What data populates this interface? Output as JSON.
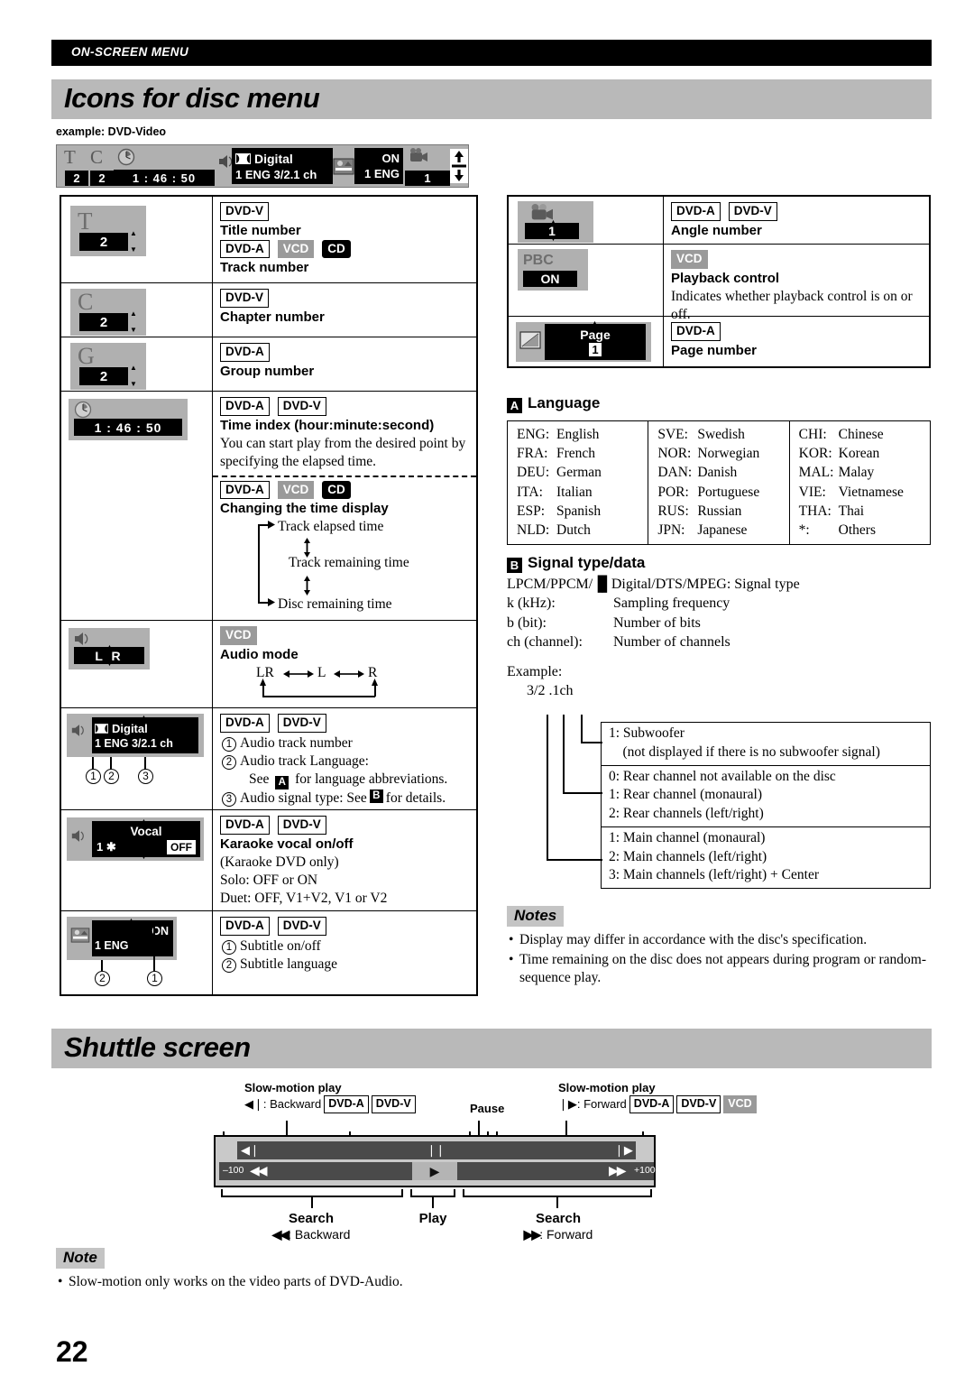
{
  "running_head": "ON-SCREEN MENU",
  "page_number": "22",
  "sections": {
    "icons_for_disc_menu": "Icons for disc menu",
    "shuttle_screen": "Shuttle screen"
  },
  "example_label": "example: DVD-Video",
  "osd_example": {
    "title_icon": "T",
    "title_value": "2",
    "chapter_icon": "C",
    "chapter_value": "2",
    "clock_icon": "clock",
    "time_value": "1 : 46 : 50",
    "speaker_icon": "speaker",
    "audio_format": "Digital",
    "audio_line2": "1 ENG   3/2.1 ch",
    "subtitle_icon": "subtitle",
    "subtitle_on": "ON",
    "subtitle_lang": "1  ENG",
    "angle_icon": "camera",
    "angle_value": "1",
    "updown_icon": "up-down-arrows"
  },
  "badges": {
    "dvd_a": "DVD-A",
    "dvd_v": "DVD-V",
    "vcd": "VCD",
    "cd": "CD"
  },
  "table_left": [
    {
      "id": "title-track-number",
      "thumb": {
        "glyph": "T",
        "value": "2"
      },
      "lines": [
        {
          "type": "badges",
          "items": [
            "DVD-V"
          ]
        },
        {
          "type": "head",
          "text": "Title number"
        },
        {
          "type": "badges",
          "items": [
            "DVD-A",
            "VCD",
            "CD"
          ]
        },
        {
          "type": "head",
          "text": "Track number"
        }
      ]
    },
    {
      "id": "chapter-number",
      "thumb": {
        "glyph": "C",
        "value": "2"
      },
      "lines": [
        {
          "type": "badges",
          "items": [
            "DVD-V"
          ]
        },
        {
          "type": "head",
          "text": "Chapter number"
        }
      ]
    },
    {
      "id": "group-number",
      "thumb": {
        "glyph": "G",
        "value": "2"
      },
      "lines": [
        {
          "type": "badges",
          "items": [
            "DVD-A"
          ]
        },
        {
          "type": "head",
          "text": "Group number"
        }
      ]
    },
    {
      "id": "time-index",
      "thumb": {
        "glyph": "clock",
        "value": "1 : 46 : 50"
      },
      "lines": [
        {
          "type": "badges",
          "items": [
            "DVD-A",
            "DVD-V"
          ]
        },
        {
          "type": "head",
          "text": "Time index (hour:minute:second)"
        },
        {
          "type": "body",
          "text": "You can start play from the desired point by specifying the elapsed time."
        },
        {
          "type": "dashed"
        },
        {
          "type": "badges",
          "items": [
            "DVD-A",
            "VCD",
            "CD"
          ]
        },
        {
          "type": "head",
          "text": "Changing the time display"
        },
        {
          "type": "cycle",
          "items": [
            "Track elapsed time",
            "Track remaining time",
            "Disc remaining time"
          ]
        }
      ]
    },
    {
      "id": "audio-mode",
      "thumb": {
        "glyph": "speaker",
        "value": "L  R"
      },
      "lines": [
        {
          "type": "badges",
          "items": [
            "VCD"
          ]
        },
        {
          "type": "head",
          "text": "Audio mode"
        },
        {
          "type": "lrcycle",
          "items": [
            "LR",
            "L",
            "R"
          ]
        }
      ]
    },
    {
      "id": "audio-track",
      "thumb": {
        "glyph": "speaker-digital",
        "value": "1 ENG  3/2.1 ch",
        "format": "Digital",
        "callouts": [
          "1",
          "2",
          "3"
        ]
      },
      "lines": [
        {
          "type": "badges",
          "items": [
            "DVD-A",
            "DVD-V"
          ]
        },
        {
          "type": "numbered",
          "num": "1",
          "text": "Audio track number"
        },
        {
          "type": "numbered",
          "num": "2",
          "text": "Audio track Language:"
        },
        {
          "type": "indent-ref",
          "pre": "See ",
          "badge": "A",
          "post": " for language abbreviations."
        },
        {
          "type": "numbered-ref",
          "num": "3",
          "pre": "Audio signal type: See ",
          "badge": "B",
          "post": " for details."
        }
      ]
    },
    {
      "id": "karaoke-vocal",
      "thumb": {
        "glyph": "speaker-vocal",
        "label": "Vocal",
        "value": "1  ✱",
        "state": "OFF"
      },
      "lines": [
        {
          "type": "badges",
          "items": [
            "DVD-A",
            "DVD-V"
          ]
        },
        {
          "type": "head",
          "text": "Karaoke vocal on/off"
        },
        {
          "type": "body",
          "text": "(Karaoke DVD only)"
        },
        {
          "type": "body",
          "text": "Solo: OFF or ON"
        },
        {
          "type": "body",
          "text": "Duet: OFF, V1+V2, V1 or V2"
        }
      ]
    },
    {
      "id": "subtitle",
      "thumb": {
        "glyph": "subtitle",
        "on": "ON",
        "value": "1  ENG",
        "callouts": [
          "2",
          "1"
        ]
      },
      "lines": [
        {
          "type": "badges",
          "items": [
            "DVD-A",
            "DVD-V"
          ]
        },
        {
          "type": "numbered",
          "num": "1",
          "text": "Subtitle on/off"
        },
        {
          "type": "numbered",
          "num": "2",
          "text": "Subtitle language"
        }
      ]
    }
  ],
  "table_right": [
    {
      "id": "angle-number",
      "thumb": {
        "glyph": "camera",
        "value": "1"
      },
      "lines": [
        {
          "type": "badges",
          "items": [
            "DVD-A",
            "DVD-V"
          ]
        },
        {
          "type": "head",
          "text": "Angle number"
        }
      ]
    },
    {
      "id": "playback-control",
      "thumb": {
        "glyph": "PBC",
        "value": "ON"
      },
      "lines": [
        {
          "type": "badges",
          "items": [
            "VCD"
          ]
        },
        {
          "type": "head",
          "text": "Playback control"
        },
        {
          "type": "body",
          "text": "Indicates whether playback control is on or off."
        }
      ]
    },
    {
      "id": "page-number-row",
      "thumb": {
        "glyph": "page",
        "label": "Page",
        "value": "1"
      },
      "lines": [
        {
          "type": "badges",
          "items": [
            "DVD-A"
          ]
        },
        {
          "type": "head",
          "text": "Page number"
        }
      ]
    }
  ],
  "language_section": {
    "badge": "A",
    "title": "Language",
    "columns": [
      [
        {
          "abbr": "ENG:",
          "name": "English"
        },
        {
          "abbr": "FRA:",
          "name": "French"
        },
        {
          "abbr": "DEU:",
          "name": "German"
        },
        {
          "abbr": "ITA:",
          "name": "Italian"
        },
        {
          "abbr": "ESP:",
          "name": "Spanish"
        },
        {
          "abbr": "NLD:",
          "name": "Dutch"
        }
      ],
      [
        {
          "abbr": "SVE:",
          "name": "Swedish"
        },
        {
          "abbr": "NOR:",
          "name": "Norwegian"
        },
        {
          "abbr": "DAN:",
          "name": "Danish"
        },
        {
          "abbr": "POR:",
          "name": "Portuguese"
        },
        {
          "abbr": "RUS:",
          "name": "Russian"
        },
        {
          "abbr": "JPN:",
          "name": "Japanese"
        }
      ],
      [
        {
          "abbr": "CHI:",
          "name": "Chinese"
        },
        {
          "abbr": "KOR:",
          "name": "Korean"
        },
        {
          "abbr": "MAL:",
          "name": "Malay"
        },
        {
          "abbr": "VIE:",
          "name": "Vietnamese"
        },
        {
          "abbr": "THA:",
          "name": "Thai"
        },
        {
          "abbr": "*:",
          "name": "Others"
        }
      ]
    ]
  },
  "signal_section": {
    "badge": "B",
    "title": "Signal type/data",
    "type_line_pre": "LPCM/PPCM/",
    "type_line_dd": "▐▌",
    "type_line_post": "Digital/DTS/MPEG: Signal type",
    "rows": [
      {
        "label": "k (kHz):",
        "desc": "Sampling frequency"
      },
      {
        "label": "b (bit):",
        "desc": "Number of bits"
      },
      {
        "label": "ch (channel):",
        "desc": "Number of channels"
      }
    ],
    "example_label": "Example:",
    "example_value": "3/2 .1ch",
    "groups": [
      [
        "1: Subwoofer",
        "    (not displayed if there is no subwoofer signal)"
      ],
      [
        "0: Rear channel not available on the disc",
        "1: Rear channel (monaural)",
        "2: Rear channels (left/right)"
      ],
      [
        "1: Main channel (monaural)",
        "2: Main channels (left/right)",
        "3: Main channels (left/right) + Center"
      ]
    ]
  },
  "notes_main": {
    "title": "Notes",
    "items": [
      "Display may differ in accordance with the disc's specification.",
      "Time remaining on the disc does not appears during program or random-sequence play."
    ]
  },
  "shuttle": {
    "slow_backward": {
      "title": "Slow-motion play",
      "text": ": Backward",
      "arrow": "◀❘",
      "badges": [
        "DVD-A",
        "DVD-V"
      ]
    },
    "pause_label": "Pause",
    "slow_forward": {
      "title": "Slow-motion play",
      "text": ": Forward",
      "arrow": "❘▶",
      "badges": [
        "DVD-A",
        "DVD-V",
        "VCD"
      ]
    },
    "bar": {
      "left_scale": "–100",
      "right_scale": "+100",
      "slow_back_icon": "◀❘",
      "pause_icon": "❘❘",
      "slow_fwd_icon": "❘▶",
      "search_back_icon": "◀◀",
      "play_icon": "▶",
      "search_fwd_icon": "▶▶"
    },
    "search_backward": {
      "title": "Search",
      "text": ": Backward",
      "arrow": "◀◀"
    },
    "play_label": "Play",
    "search_forward": {
      "title": "Search",
      "text": ": Forward",
      "arrow": "▶▶"
    }
  },
  "note_bottom": {
    "title": "Note",
    "items": [
      "Slow-motion only works on the video parts of DVD-Audio."
    ]
  }
}
